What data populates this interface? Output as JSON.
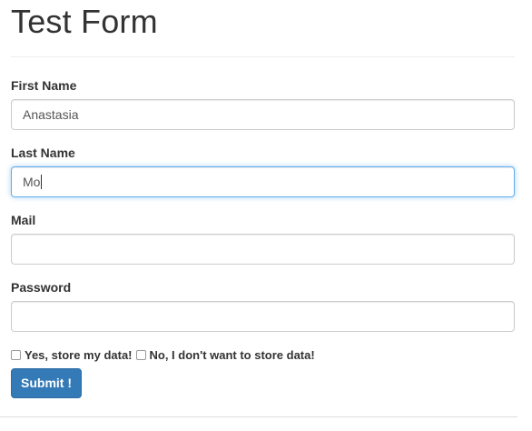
{
  "form": {
    "title": "Test Form",
    "first_name": {
      "label": "First Name",
      "value": "Anastasia"
    },
    "last_name": {
      "label": "Last Name",
      "value": "Mo",
      "focused": true
    },
    "mail": {
      "label": "Mail",
      "value": ""
    },
    "password": {
      "label": "Password",
      "value": ""
    },
    "consent_yes": {
      "label": "Yes, store my data!",
      "checked": false
    },
    "consent_no": {
      "label": "No, I don't want to store data!",
      "checked": false
    },
    "submit_label": "Submit !"
  },
  "colors": {
    "primary_button": "#337ab7",
    "focus_border": "#66afe9"
  }
}
